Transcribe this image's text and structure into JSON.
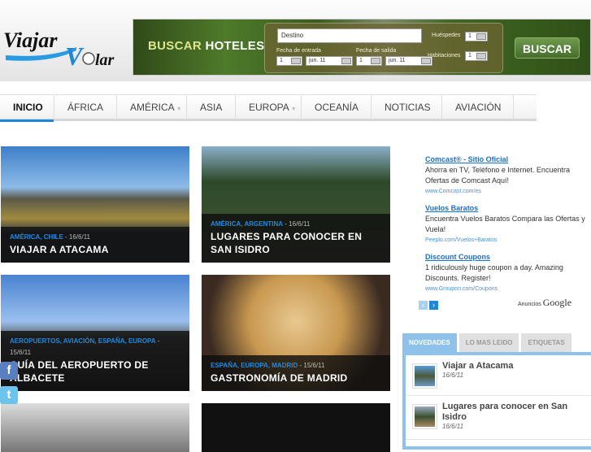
{
  "logo": {
    "text": "Viajar Volar"
  },
  "banner": {
    "title_a": "BUSCAR",
    "title_b": "HOTELES",
    "destino": "Destino",
    "huespedes_label": "Huéspedes",
    "huespedes": "1",
    "habitaciones_label": "Habitaciones",
    "habitaciones": "1",
    "entrada_label": "Fecha de entrada",
    "entrada_day": "1",
    "entrada_month": "jun. 11",
    "salida_label": "Fecha de salida",
    "salida_day": "1",
    "salida_month": "jun. 11",
    "button": "BUSCAR"
  },
  "nav": [
    "INICIO",
    "ÁFRICA",
    "AMÉRICA",
    "ASIA",
    "EUROPA",
    "OCEANÍA",
    "NOTICIAS",
    "AVIACIÓN"
  ],
  "posts": [
    {
      "cats": "AMÉRICA, CHILE",
      "date": "- 16/6/11",
      "title": "VIAJAR A ATACAMA"
    },
    {
      "cats": "AMÉRICA, ARGENTINA",
      "date": "- 16/6/11",
      "title": "LUGARES PARA CONOCER EN SAN ISIDRO"
    },
    {
      "cats": "AEROPUERTOS, AVIACIÓN, ESPAÑA, EUROPA",
      "date": "- 15/6/11",
      "title": "GUÍA DEL AEROPUERTO DE ALBACETE"
    },
    {
      "cats": "ESPAÑA, EUROPA, MADRID",
      "date": "- 15/6/11",
      "title": "GASTRONOMÍA DE MADRID"
    }
  ],
  "ads": [
    {
      "title": "Comcast® - Sitio Oficial",
      "text": "Ahorra en TV, Teléfono e Internet. Encuentra Ofertas de Comcast Aquí!",
      "url": "www.Comcast.com/es"
    },
    {
      "title": "Vuelos Baratos",
      "text": "Encuentra Vuelos Baratos Compara las Ofertas y Vuela!",
      "url": "Peeplo.com/Vuelos+Baratos"
    },
    {
      "title": "Discount Coupons",
      "text": "1 ridiculously huge coupon a day. Amazing Discounts. Register!",
      "url": "www.Groupon.com/Coupons"
    }
  ],
  "ads_label": "Anuncios",
  "ads_brand": "Google",
  "tabs": [
    "NOVEDADES",
    "LO MAS LEIDO",
    "ETIQUETAS"
  ],
  "recent": [
    {
      "title": "Viajar a Atacama",
      "date": "16/6/11"
    },
    {
      "title": "Lugares para conocer en San Isidro",
      "date": "16/6/11"
    }
  ],
  "colors": {
    "accent": "#1e88d6",
    "tab": "#8ec2ea"
  }
}
